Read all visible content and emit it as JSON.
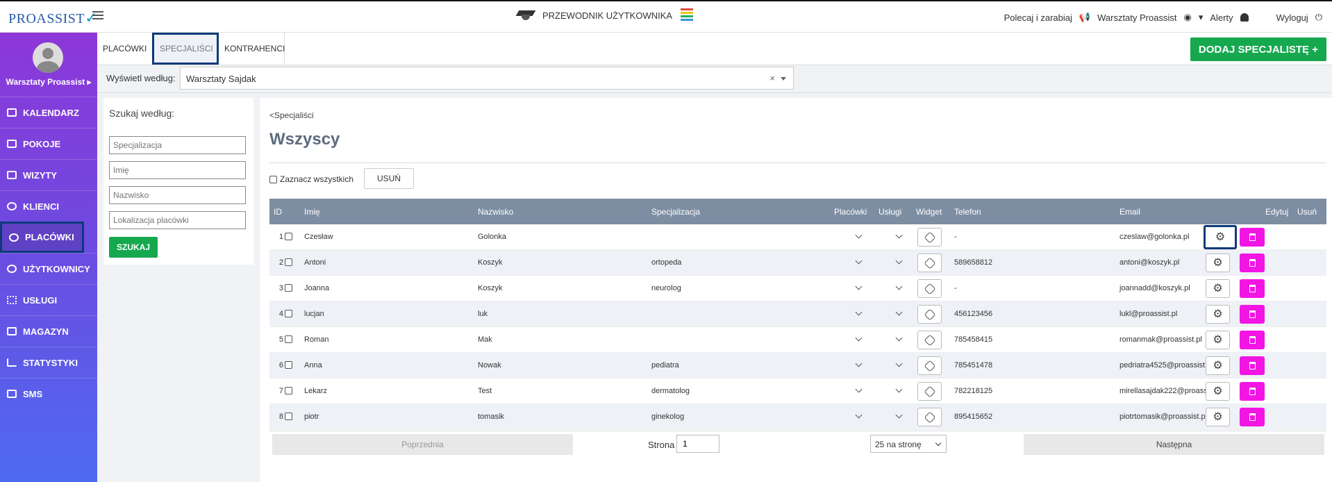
{
  "topbar": {
    "logo": "PROASSIST",
    "guide_label": "PRZEWODNIK UŻYTKOWNIKA",
    "refer_label": "Polecaj i zarabiaj",
    "account_label": "Warsztaty Proassist",
    "alerts_label": "Alerty",
    "logout_label": "Wyloguj"
  },
  "sidebar": {
    "user_name": "Warsztaty Proassist ▸",
    "items": [
      {
        "label": "KALENDARZ",
        "icon": "calendar-icon"
      },
      {
        "label": "POKOJE",
        "icon": "calendar-icon"
      },
      {
        "label": "WIZYTY",
        "icon": "list-icon"
      },
      {
        "label": "KLIENCI",
        "icon": "users-icon"
      },
      {
        "label": "PLACÓWKI",
        "icon": "user-plus-icon"
      },
      {
        "label": "UŻYTKOWNICY",
        "icon": "user-circle-icon"
      },
      {
        "label": "USŁUGI",
        "icon": "grid-icon"
      },
      {
        "label": "MAGAZYN",
        "icon": "box-icon"
      },
      {
        "label": "STATYSTYKI",
        "icon": "bar-chart-icon"
      },
      {
        "label": "SMS",
        "icon": "message-icon"
      }
    ]
  },
  "tabs": [
    "PLACÓWKI",
    "SPECJALIŚCI",
    "KONTRAHENCI"
  ],
  "add_button": "DODAJ SPECJALISTĘ +",
  "filter": {
    "label": "Wyświetl według:",
    "value": "Warsztaty Sajdak"
  },
  "search": {
    "title": "Szukaj według:",
    "placeholders": [
      "Specjalizacja",
      "Imię",
      "Nazwisko",
      "Lokalizacja placówki"
    ],
    "button": "SZUKAJ"
  },
  "main": {
    "breadcrumb": "<Specjaliści",
    "title": "Wszyscy",
    "select_all": "Zaznacz wszystkich",
    "delete_button": "USUŃ"
  },
  "table": {
    "headers": [
      "ID",
      "Imię",
      "Nazwisko",
      "Specjalizacja",
      "Placówki",
      "Usługi",
      "Widget",
      "Telefon",
      "Email",
      "Edytuj",
      "Usuń"
    ],
    "rows": [
      {
        "id": "1",
        "first": "Czesław",
        "last": "Golonka",
        "spec": "",
        "phone": "-",
        "email": "czeslaw@golonka.pl"
      },
      {
        "id": "2",
        "first": "Antoni",
        "last": "Koszyk",
        "spec": "ortopeda",
        "phone": "589658812",
        "email": "antoni@koszyk.pl"
      },
      {
        "id": "3",
        "first": "Joanna",
        "last": "Koszyk",
        "spec": "neurolog",
        "phone": "-",
        "email": "joannadd@koszyk.pl"
      },
      {
        "id": "4",
        "first": "lucjan",
        "last": "luk",
        "spec": "",
        "phone": "456123456",
        "email": "lukl@proassist.pl"
      },
      {
        "id": "5",
        "first": "Roman",
        "last": "Mak",
        "spec": "",
        "phone": "785458415",
        "email": "romanmak@proassist.pl"
      },
      {
        "id": "6",
        "first": "Anna",
        "last": "Nowak",
        "spec": "pediatra",
        "phone": "785451478",
        "email": "pedriatra4525@proassist.pl"
      },
      {
        "id": "7",
        "first": "Lekarz",
        "last": "Test",
        "spec": "dermatolog",
        "phone": "782218125",
        "email": "mirellasajdak222@proassist.pl"
      },
      {
        "id": "8",
        "first": "piotr",
        "last": "tomasik",
        "spec": "ginekolog",
        "phone": "895415652",
        "email": "piotrtomasik@proassist.pl"
      }
    ]
  },
  "pager": {
    "prev": "Poprzednia",
    "page_label": "Strona",
    "page_value": "1",
    "per_page": "25 na stronę",
    "next": "Następna"
  }
}
